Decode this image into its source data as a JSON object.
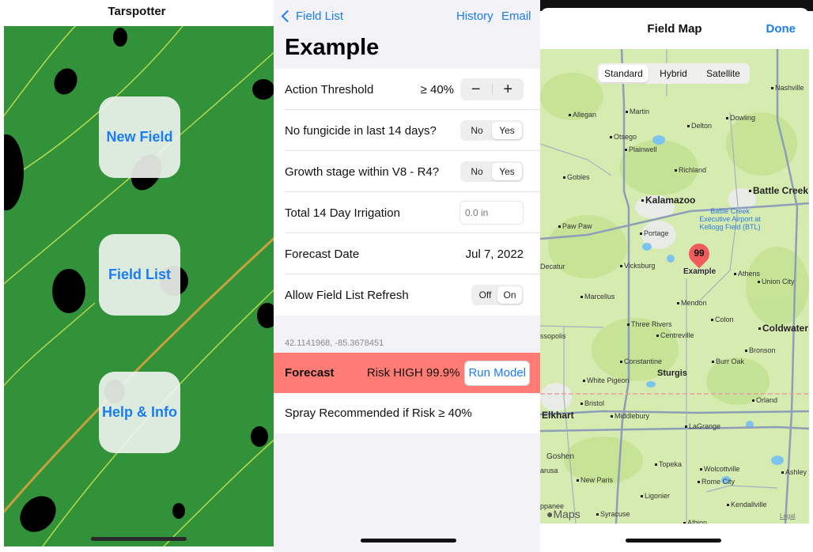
{
  "home": {
    "title": "Tarspotter",
    "buttons": [
      {
        "label": "New Field"
      },
      {
        "label": "Field List"
      },
      {
        "label": "Help & Info"
      }
    ]
  },
  "field": {
    "nav": {
      "back_label": "Field List",
      "history_label": "History",
      "email_label": "Email"
    },
    "title": "Example",
    "rows": {
      "threshold": {
        "label": "Action Threshold",
        "value": "≥ 40%",
        "decrement": "−",
        "increment": "+"
      },
      "fungicide": {
        "label": "No fungicide in last 14 days?",
        "options": [
          "No",
          "Yes"
        ],
        "selected": "Yes"
      },
      "growth": {
        "label": "Growth stage within V8 - R4?",
        "options": [
          "No",
          "Yes"
        ],
        "selected": "Yes"
      },
      "irrigation": {
        "label": "Total 14 Day Irrigation",
        "placeholder": "0.0 in",
        "value": ""
      },
      "forecast_date": {
        "label": "Forecast Date",
        "value": "Jul 7, 2022"
      },
      "refresh": {
        "label": "Allow Field List Refresh",
        "options": [
          "Off",
          "On"
        ],
        "selected": "On"
      }
    },
    "coordinates": "42.1141968, -85.3678451",
    "forecast": {
      "label": "Forecast",
      "risk": "Risk HIGH 99.9%",
      "run_label": "Run Model",
      "color": "#ff7b73"
    },
    "spray_text": "Spray Recommended if Risk ≥ 40%"
  },
  "map": {
    "title": "Field Map",
    "done_label": "Done",
    "map_types": [
      "Standard",
      "Hybrid",
      "Satellite"
    ],
    "selected_type": "Standard",
    "pin": {
      "value": "99",
      "label": "Example",
      "color": "#f25c5c"
    },
    "cities": {
      "allegan": "Allegan",
      "martin": "Martin",
      "otsego": "Otsego",
      "plainwell": "Plainwell",
      "delton": "Delton",
      "dowling": "Dowling",
      "nashville": "Nashville",
      "gobles": "Gobles",
      "richland": "Richland",
      "kalamazoo": "Kalamazoo",
      "battle_creek": "Battle Creek",
      "paw_paw": "Paw Paw",
      "portage": "Portage",
      "decatur": "Decatur",
      "vicksburg": "Vicksburg",
      "athens": "Athens",
      "union_city": "Union City",
      "marcellus": "Marcellus",
      "mendon": "Mendon",
      "colon": "Colon",
      "three_rivers": "Three Rivers",
      "coldwater": "Coldwater",
      "cassopolis": "ssopolis",
      "centreville": "Centreville",
      "bronson": "Bronson",
      "constantine": "Constantine",
      "burr_oak": "Burr Oak",
      "sturgis": "Sturgis",
      "white_pigeon": "White Pigeon",
      "bristol": "Bristol",
      "orland": "Orland",
      "elkhart": "Elkhart",
      "middlebury": "Middlebury",
      "lagrange": "LaGrange",
      "goshen": "Goshen",
      "topeka": "Topeka",
      "wolcottville": "Wolcottville",
      "ashley": "Ashley",
      "new_paris": "New Paris",
      "rome_city": "Rome City",
      "ligonier": "Ligonier",
      "kendallville": "Kendallville",
      "syracuse": "Syracuse",
      "albion": "Albion",
      "nappanee": "ppanee",
      "milford": "arusa"
    },
    "airport": "Battle Creek Executive Airport at Kellogg Field (BTL)",
    "attribution": "Maps",
    "legal": "Legal"
  }
}
